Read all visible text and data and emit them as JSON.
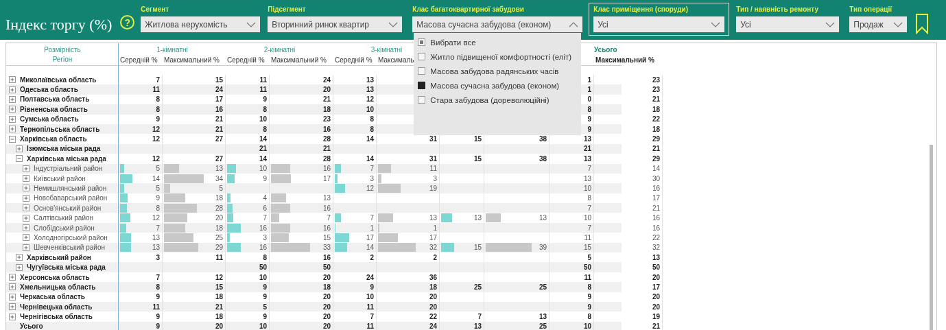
{
  "header": {
    "title": "Індекс торгу (%)",
    "help": "?"
  },
  "slicers": [
    {
      "label": "Сегмент",
      "value": "Житлова нерухомість",
      "expanded": false,
      "focused": false
    },
    {
      "label": "Підсегмент",
      "value": "Вторинний ринок квартир",
      "expanded": false,
      "focused": false
    },
    {
      "label": "Клас багатоквартирної забудови",
      "value": "Масова сучасна забудова (економ)",
      "expanded": true,
      "focused": false,
      "options": [
        {
          "label": "Вибрати все",
          "checked": false,
          "partial": true
        },
        {
          "label": "Житло підвищеної комфортності (еліт)",
          "checked": false,
          "partial": false
        },
        {
          "label": "Масова забудова радянських часів",
          "checked": false,
          "partial": false
        },
        {
          "label": "Масова сучасна забудова (економ)",
          "checked": true,
          "partial": false
        },
        {
          "label": "Стара забудова (дореволюційні)",
          "checked": false,
          "partial": false
        }
      ]
    },
    {
      "label": "Клас приміщення (споруди)",
      "value": "Усі",
      "expanded": false,
      "focused": true
    },
    {
      "label": "Тип / наявність ремонту",
      "value": "Усі",
      "expanded": false,
      "focused": false
    },
    {
      "label": "Тип операції",
      "value": "Продаж",
      "expanded": false,
      "focused": false
    }
  ],
  "table": {
    "dimension_label": "Розмірність",
    "row_header": "Регіон",
    "groups": [
      {
        "kind": "data",
        "title": "1-кімнатні",
        "columns": [
          "Середній %",
          "Максимальний %"
        ]
      },
      {
        "kind": "data",
        "title": "2-кімнатні",
        "columns": [
          "Середній %",
          "Максимальний %"
        ]
      },
      {
        "kind": "data",
        "title": "3-кімнатні",
        "columns": [
          "Середній %",
          "Максималь"
        ]
      },
      {
        "kind": "data",
        "columns": [
          null,
          null
        ]
      },
      {
        "kind": "total",
        "title": "Усього",
        "columns": [
          null,
          "Максимальний %"
        ]
      }
    ],
    "rows": [
      {
        "kind": "region",
        "name": "Миколаївська область",
        "expanded": false,
        "cells": [
          "7",
          "15",
          "11",
          "24",
          "13",
          null,
          null,
          null,
          "1",
          "23"
        ]
      },
      {
        "kind": "region",
        "name": "Одеська область",
        "expanded": false,
        "cells": [
          "11",
          "24",
          "11",
          "20",
          "13",
          null,
          null,
          null,
          "1",
          "23"
        ]
      },
      {
        "kind": "region",
        "name": "Полтавська область",
        "expanded": false,
        "cells": [
          "8",
          "17",
          "9",
          "21",
          "12",
          null,
          null,
          null,
          "0",
          "21"
        ]
      },
      {
        "kind": "region",
        "name": "Рівненська область",
        "expanded": false,
        "cells": [
          "8",
          "16",
          "8",
          "18",
          "10",
          null,
          null,
          null,
          "8",
          "18"
        ]
      },
      {
        "kind": "region",
        "name": "Сумська область",
        "expanded": false,
        "cells": [
          "9",
          "21",
          "10",
          "23",
          "8",
          null,
          null,
          null,
          "9",
          "22"
        ]
      },
      {
        "kind": "region",
        "name": "Тернопільська область",
        "expanded": false,
        "cells": [
          "12",
          "21",
          "8",
          "16",
          "8",
          null,
          null,
          null,
          "9",
          "18"
        ]
      },
      {
        "kind": "region",
        "name": "Харківська область",
        "expanded": true,
        "cells": [
          "12",
          "27",
          "14",
          "28",
          "14",
          "31",
          "15",
          "38",
          "13",
          "29"
        ],
        "children": [
          {
            "kind": "region",
            "name": "Ізюмська міська рада",
            "expanded": false,
            "cells": [
              null,
              null,
              "21",
              "21",
              null,
              null,
              null,
              null,
              "21",
              "21"
            ]
          },
          {
            "kind": "region",
            "name": "Харківська міська рада",
            "expanded": true,
            "cells": [
              "12",
              "27",
              "14",
              "28",
              "14",
              "31",
              "15",
              "38",
              "13",
              "29"
            ],
            "children": [
              {
                "kind": "region",
                "name": "Індустріальний район",
                "expanded": false,
                "bars": true,
                "cells": [
                  "5",
                  "13",
                  "10",
                  "16",
                  "7",
                  "11",
                  null,
                  null,
                  "7",
                  "14"
                ]
              },
              {
                "kind": "region",
                "name": "Київський район",
                "expanded": false,
                "bars": true,
                "cells": [
                  "14",
                  "34",
                  "9",
                  "17",
                  "3",
                  "3",
                  null,
                  null,
                  "13",
                  "30"
                ]
              },
              {
                "kind": "region",
                "name": "Немишлянський район",
                "expanded": false,
                "bars": true,
                "cells": [
                  "5",
                  "5",
                  null,
                  null,
                  "12",
                  "19",
                  null,
                  null,
                  "10",
                  "16"
                ]
              },
              {
                "kind": "region",
                "name": "Новобаварський район",
                "expanded": false,
                "bars": true,
                "cells": [
                  "9",
                  "18",
                  "4",
                  "13",
                  null,
                  null,
                  null,
                  null,
                  "8",
                  "17"
                ]
              },
              {
                "kind": "region",
                "name": "Основ'янський район",
                "expanded": false,
                "bars": true,
                "cells": [
                  "8",
                  "28",
                  "6",
                  "16",
                  null,
                  null,
                  null,
                  null,
                  "7",
                  "21"
                ]
              },
              {
                "kind": "region",
                "name": "Салтівський район",
                "expanded": false,
                "bars": true,
                "cells": [
                  "12",
                  "20",
                  "7",
                  "7",
                  "7",
                  "13",
                  "13",
                  "13",
                  "10",
                  "16"
                ]
              },
              {
                "kind": "region",
                "name": "Слобідський район",
                "expanded": false,
                "bars": true,
                "cells": [
                  "7",
                  "18",
                  "16",
                  "16",
                  "1",
                  "1",
                  null,
                  null,
                  "7",
                  "16"
                ]
              },
              {
                "kind": "region",
                "name": "Холодногірський район",
                "expanded": false,
                "bars": true,
                "cells": [
                  "13",
                  "25",
                  "3",
                  "15",
                  "17",
                  "17",
                  null,
                  null,
                  "11",
                  "22"
                ]
              },
              {
                "kind": "region",
                "name": "Шевченківський район",
                "expanded": false,
                "bars": true,
                "cells": [
                  "13",
                  "29",
                  "16",
                  "33",
                  "14",
                  "32",
                  "15",
                  "39",
                  "15",
                  "32"
                ]
              }
            ]
          },
          {
            "kind": "region",
            "name": "Харківський район",
            "expanded": false,
            "cells": [
              "3",
              "11",
              "8",
              "16",
              "2",
              "2",
              null,
              null,
              "5",
              "13"
            ]
          },
          {
            "kind": "region",
            "name": "Чугуївська міська рада",
            "expanded": false,
            "cells": [
              null,
              null,
              "50",
              "50",
              null,
              null,
              null,
              null,
              "50",
              "50"
            ]
          }
        ]
      },
      {
        "kind": "region",
        "name": "Херсонська область",
        "expanded": false,
        "cells": [
          "7",
          "12",
          "10",
          "20",
          "24",
          "36",
          null,
          null,
          "11",
          "20"
        ]
      },
      {
        "kind": "region",
        "name": "Хмельницька область",
        "expanded": false,
        "cells": [
          "8",
          "15",
          "9",
          "18",
          "9",
          "18",
          "25",
          "25",
          "8",
          "17"
        ]
      },
      {
        "kind": "region",
        "name": "Черкаська область",
        "expanded": false,
        "cells": [
          "9",
          "18",
          "9",
          "20",
          "10",
          "20",
          null,
          null,
          "9",
          "20"
        ]
      },
      {
        "kind": "region",
        "name": "Чернівецька область",
        "expanded": false,
        "cells": [
          "11",
          "21",
          "5",
          "20",
          "11",
          "20",
          null,
          null,
          "9",
          "20"
        ]
      },
      {
        "kind": "region",
        "name": "Чернігівська область",
        "expanded": false,
        "cells": [
          "9",
          "18",
          "9",
          "20",
          "7",
          "22",
          "7",
          "13",
          "8",
          "19"
        ]
      },
      {
        "kind": "total",
        "name": "Усього",
        "cells": [
          "9",
          "20",
          "10",
          "20",
          "11",
          "24",
          "13",
          "25",
          "10",
          "21"
        ]
      }
    ]
  }
}
